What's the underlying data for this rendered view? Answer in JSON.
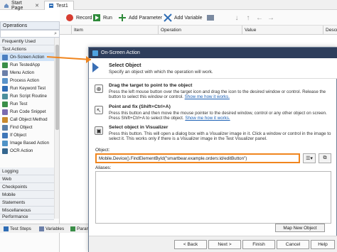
{
  "tabs": {
    "start_page": "Start Page",
    "test1": "Test1"
  },
  "toolbar": {
    "record": "Record",
    "run": "Run",
    "add_parameter": "Add Parameter",
    "add_variable": "Add Variable",
    "record_icon": "record-icon",
    "run_icon": "run-icon"
  },
  "grid": {
    "columns": [
      "Item",
      "Operation",
      "Value",
      "Descr"
    ]
  },
  "left_panel": {
    "header": "Operations",
    "categories_top": [
      "Frequently Used",
      "Test Actions"
    ],
    "items": [
      "On-Screen Action",
      "Run TestedApp",
      "Menu Action",
      "Process Action",
      "Run Keyword Test",
      "Run Script Routine",
      "Run Test",
      "Run Code Snippet",
      "Call Object Method",
      "Find Object",
      "If Object",
      "Image Based Action",
      "OCR Action"
    ],
    "categories_bottom": [
      "Logging",
      "Web",
      "Checkpoints",
      "Mobile",
      "Statements",
      "Miscellaneous",
      "Performance"
    ]
  },
  "bottom_tabs": {
    "test_steps": "Test Steps",
    "variables": "Variables",
    "params": "Param"
  },
  "dialog": {
    "title": "On-Screen Action",
    "header_title": "Select Object",
    "header_subtitle": "Specify an object with which the operation will work.",
    "options": [
      {
        "title": "Drag the target to point to the object",
        "text": "Press the left mouse button over the target icon and drag the icon to the desired window or control. Release the button to select this window or control.",
        "link": "Show me how it works."
      },
      {
        "title": "Point and fix (Shift+Ctrl+A)",
        "text": "Press this button and then move the mouse pointer to the desired window, control or any other object on screen. Press Shift+Ctrl+A to select the object.",
        "link": "Show me how it works."
      },
      {
        "title": "Select object in Visualizer",
        "text": "Press this button. This will open a dialog box with a Visualizer image in it. Click a window or control in the image to select it. This works only if there is a Visualizer image in the Test Visualizer panel.",
        "link": ""
      }
    ],
    "object_label": "Object:",
    "object_value": "Mobile.Device().FindElementById(\"smartbear.example.orders:id/editButton\")",
    "aliases_label": "Aliases:",
    "map_button": "Map New Object",
    "back": "< Back",
    "next": "Next >",
    "finish": "Finish",
    "cancel": "Cancel",
    "help": "Help"
  },
  "colors": {
    "dialog_title_bg": "#2e3e5c",
    "highlight": "#f0851e",
    "selection": "#cfe3f8"
  }
}
